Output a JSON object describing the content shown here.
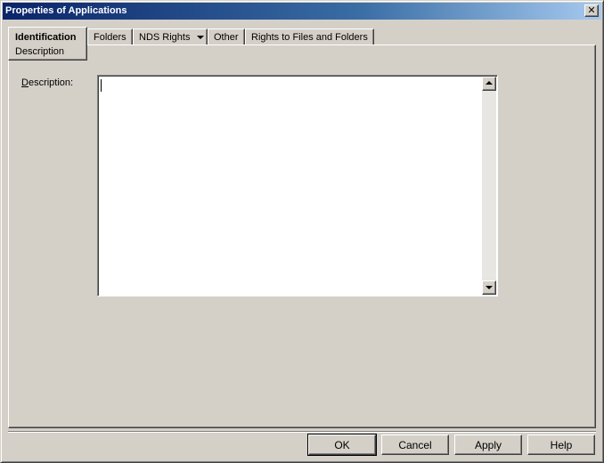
{
  "window": {
    "title": "Properties of Applications",
    "close_glyph": "✕"
  },
  "tabs": {
    "active": {
      "label": "Identification",
      "sub_label": "Description"
    },
    "items": [
      {
        "label": "Folders"
      },
      {
        "label": "NDS Rights"
      },
      {
        "label": "Other"
      },
      {
        "label": "Rights to Files and Folders"
      }
    ]
  },
  "form": {
    "description_label_accel": "D",
    "description_label_rest": "escription:",
    "description_value": ""
  },
  "buttons": {
    "ok": "OK",
    "cancel": "Cancel",
    "apply": "Apply",
    "help": "Help"
  }
}
